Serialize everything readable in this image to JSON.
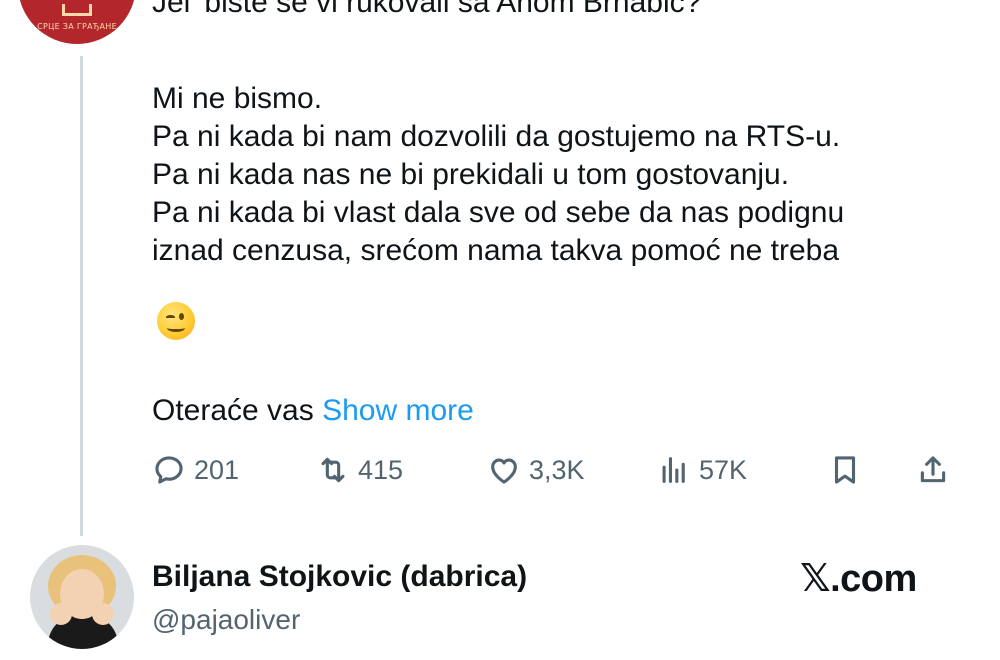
{
  "tweet": {
    "first_line": "Jel' biste se vi rukovali sa Anom Brnabić?",
    "lines": [
      "Mi ne bismo.",
      "Pa ni kada bi nam dozvolili da gostujemo na RTS-u.",
      "Pa ni kada nas ne bi prekidali u tom gostovanju.",
      "Pa ni kada bi vlast dala sve od sebe da nas podignu",
      "iznad cenzusa, srećom nama takva pomoć ne treba"
    ],
    "emoji": "winking-face",
    "truncated_text": "Oteraće vas",
    "show_more": "Show more"
  },
  "actions": {
    "replies": "201",
    "reposts": "415",
    "likes": "3,3K",
    "views": "57K"
  },
  "author": {
    "name": "Biljana Stojkovic (dabrica)",
    "handle": "@pajaoliver"
  },
  "brand": "𝕏.com",
  "top_avatar": {
    "logo_text": "СРЦЕ ЗА ГРАЂАНЕ"
  },
  "colors": {
    "link": "#1d9bf0",
    "text": "#0f1419",
    "muted": "#536471",
    "avatar_bg": "#b3262c"
  }
}
